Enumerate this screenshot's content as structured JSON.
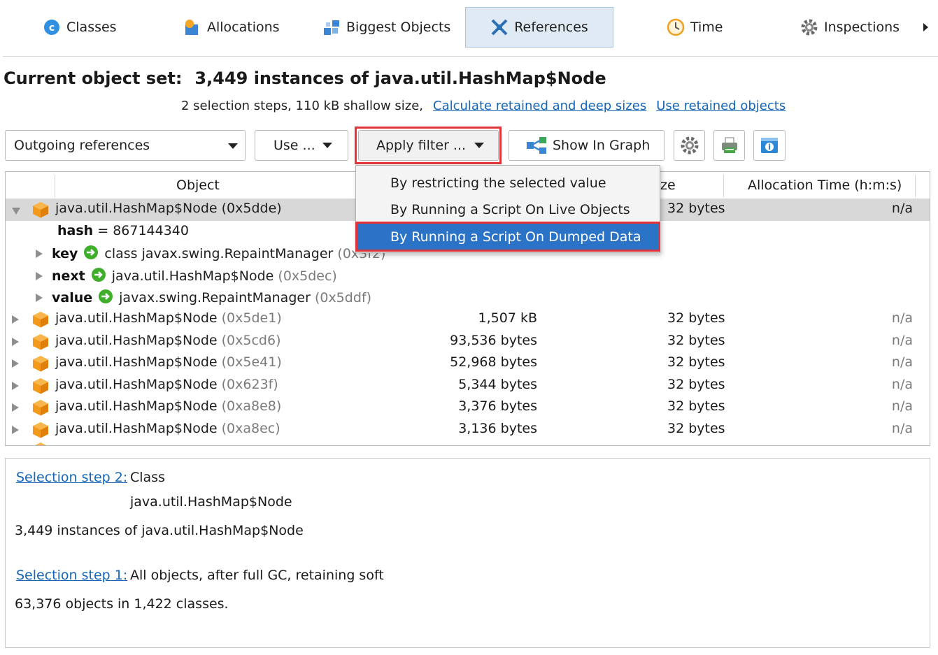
{
  "tabs": [
    {
      "label": "Classes",
      "icon": "classes-icon"
    },
    {
      "label": "Allocations",
      "icon": "allocations-icon"
    },
    {
      "label": "Biggest Objects",
      "icon": "biggest-objects-icon"
    },
    {
      "label": "References",
      "icon": "references-icon",
      "active": true
    },
    {
      "label": "Time",
      "icon": "clock-icon"
    },
    {
      "label": "Inspections",
      "icon": "gear-icon"
    }
  ],
  "header": {
    "label": "Current object set:",
    "value": "3,449 instances of java.util.HashMap$Node",
    "steps_info": "2 selection steps, 110 kB shallow size,",
    "link_calc": "Calculate retained and deep sizes",
    "link_retained": "Use retained objects"
  },
  "toolbar": {
    "view_select": "Outgoing references",
    "use_label": "Use ...",
    "apply_filter_label": "Apply filter ...",
    "show_in_graph_label": "Show In Graph"
  },
  "menu": {
    "items": [
      "By restricting the selected value",
      "By Running a Script On Live Objects",
      "By Running a Script On Dumped Data"
    ],
    "active_index": 2
  },
  "table": {
    "headers": {
      "object": "Object",
      "size_partial": "ze",
      "alloc_time": "Allocation Time (h:m:s)"
    },
    "selected": {
      "name": "java.util.HashMap$Node (0x5dde)",
      "shallow": "32 bytes",
      "time": "n/a"
    },
    "hash": {
      "name": "hash",
      "eq": " = ",
      "value": "867144340"
    },
    "children": [
      {
        "field": "key",
        "name": "class javax.swing.RepaintManager",
        "addr": "(0x3f2)"
      },
      {
        "field": "next",
        "name": "java.util.HashMap$Node",
        "addr": "(0x5dec)"
      },
      {
        "field": "value",
        "name": "javax.swing.RepaintManager",
        "addr": "(0x5ddf)"
      }
    ],
    "rows": [
      {
        "name": "java.util.HashMap$Node",
        "addr": "(0x5de1)",
        "retained": "1,507 kB",
        "shallow": "32 bytes",
        "time": "n/a"
      },
      {
        "name": "java.util.HashMap$Node",
        "addr": "(0x5cd6)",
        "retained": "93,536 bytes",
        "shallow": "32 bytes",
        "time": "n/a"
      },
      {
        "name": "java.util.HashMap$Node",
        "addr": "(0x5e41)",
        "retained": "52,968 bytes",
        "shallow": "32 bytes",
        "time": "n/a"
      },
      {
        "name": "java.util.HashMap$Node",
        "addr": "(0x623f)",
        "retained": "5,344 bytes",
        "shallow": "32 bytes",
        "time": "n/a"
      },
      {
        "name": "java.util.HashMap$Node",
        "addr": "(0xa8e8)",
        "retained": "3,376 bytes",
        "shallow": "32 bytes",
        "time": "n/a"
      },
      {
        "name": "java.util.HashMap$Node",
        "addr": "(0xa8ec)",
        "retained": "3,136 bytes",
        "shallow": "32 bytes",
        "time": "n/a"
      }
    ]
  },
  "pane": {
    "step2_link": "Selection step 2:",
    "step2_kind": "Class",
    "step2_class": "java.util.HashMap$Node",
    "step2_summary": "3,449 instances of java.util.HashMap$Node",
    "step1_link": "Selection step 1:",
    "step1_desc": "All objects, after full GC, retaining soft",
    "step1_summary": "63,376 objects in 1,422 classes."
  },
  "colors": {
    "highlight": "#e0343a",
    "menu_active": "#2b73c7",
    "link": "#1566b7",
    "object_cube": "#f39a1d"
  }
}
